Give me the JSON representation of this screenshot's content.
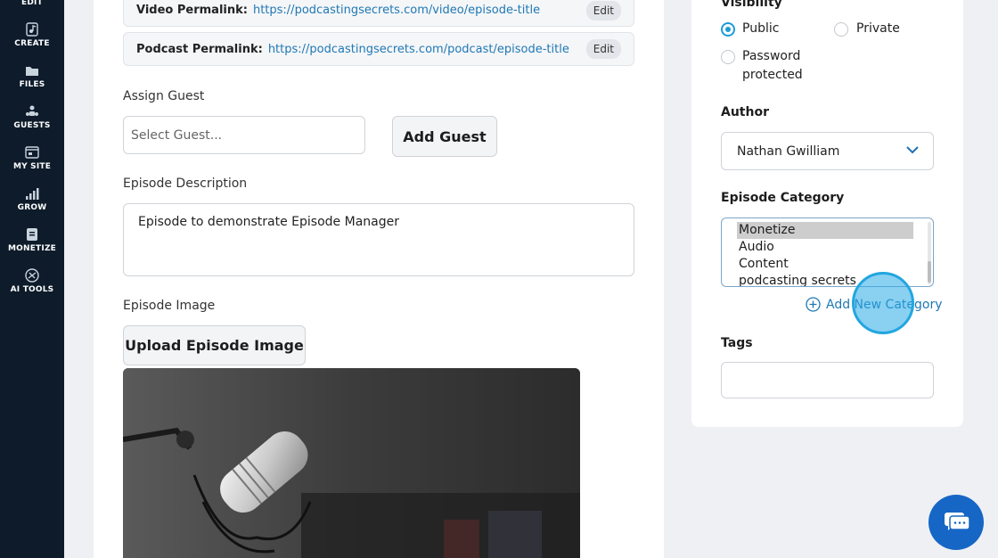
{
  "sidebar": {
    "items": [
      {
        "label": "EDIT",
        "icon": "edit-icon"
      },
      {
        "label": "CREATE",
        "icon": "music-note-icon"
      },
      {
        "label": "FILES",
        "icon": "folder-icon"
      },
      {
        "label": "GUESTS",
        "icon": "guests-icon"
      },
      {
        "label": "MY SITE",
        "icon": "website-icon"
      },
      {
        "label": "GROW",
        "icon": "bar-chart-icon"
      },
      {
        "label": "MONETIZE",
        "icon": "monetize-icon"
      },
      {
        "label": "AI TOOLS",
        "icon": "ai-tools-icon"
      }
    ]
  },
  "main": {
    "video_permalink": {
      "label": "Video Permalink:",
      "url": "https://podcastingsecrets.com/video/episode-title",
      "edit": "Edit"
    },
    "podcast_permalink": {
      "label": "Podcast Permalink:",
      "url": "https://podcastingsecrets.com/podcast/episode-title",
      "edit": "Edit"
    },
    "assign_guest": {
      "label": "Assign Guest",
      "placeholder": "Select Guest...",
      "button": "Add Guest"
    },
    "description": {
      "label": "Episode Description",
      "value": "Episode to demonstrate Episode Manager"
    },
    "image": {
      "label": "Episode Image",
      "button": "Upload Episode Image"
    }
  },
  "right": {
    "visibility": {
      "label": "Visibility",
      "options": [
        "Public",
        "Private",
        "Password protected"
      ],
      "password_line1": "Password",
      "password_line2": "protected",
      "selected": "Public"
    },
    "author": {
      "label": "Author",
      "value": "Nathan Gwilliam"
    },
    "category": {
      "label": "Episode Category",
      "options": [
        "Monetize",
        "Audio",
        "Content",
        "podcasting secrets"
      ],
      "selected": "Monetize",
      "add_label": "Add New Category"
    },
    "tags": {
      "label": "Tags",
      "value": ""
    }
  },
  "colors": {
    "accent": "#1c9bd6",
    "link": "#1f78b4",
    "sidebar": "#0d1b2a",
    "chat": "#1666c5"
  }
}
